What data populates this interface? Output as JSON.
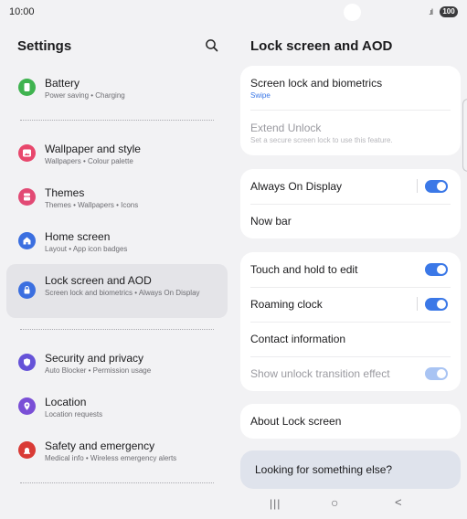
{
  "status": {
    "time": "10:00",
    "signal": ".ıl",
    "battery": "100"
  },
  "left": {
    "title": "Settings",
    "items": [
      {
        "title": "Battery",
        "sub": "Power saving  •  Charging",
        "icon": "battery-icon",
        "color": "#3fb34f"
      },
      {
        "title": "Wallpaper and style",
        "sub": "Wallpapers  •  Colour palette",
        "icon": "wallpaper-icon",
        "color": "#e8476c"
      },
      {
        "title": "Themes",
        "sub": "Themes  •  Wallpapers  •  Icons",
        "icon": "themes-icon",
        "color": "#e24a74"
      },
      {
        "title": "Home screen",
        "sub": "Layout  •  App icon badges",
        "icon": "home-icon",
        "color": "#3b6fe0"
      },
      {
        "title": "Lock screen and AOD",
        "sub": "Screen lock and biometrics  •  Always On Display",
        "icon": "lock-icon",
        "color": "#3b6fe0"
      },
      {
        "title": "Security and privacy",
        "sub": "Auto Blocker  •  Permission usage",
        "icon": "shield-icon",
        "color": "#6653d8"
      },
      {
        "title": "Location",
        "sub": "Location requests",
        "icon": "location-pin-icon",
        "color": "#7a4fd6"
      },
      {
        "title": "Safety and emergency",
        "sub": "Medical info  •  Wireless emergency alerts",
        "icon": "emergency-icon",
        "color": "#d93b36"
      }
    ]
  },
  "right": {
    "title": "Lock screen and AOD",
    "screen_lock": {
      "title": "Screen lock and biometrics",
      "sub": "Swipe"
    },
    "extend_unlock": {
      "title": "Extend Unlock",
      "sub": "Set a secure screen lock to use this feature."
    },
    "always_on": {
      "title": "Always On Display",
      "on": true
    },
    "now_bar": {
      "title": "Now bar"
    },
    "touch_hold": {
      "title": "Touch and hold to edit",
      "on": true
    },
    "roaming_clock": {
      "title": "Roaming clock",
      "on": true
    },
    "contact_info": {
      "title": "Contact information"
    },
    "unlock_effect": {
      "title": "Show unlock transition effect",
      "on": true
    },
    "about": {
      "title": "About Lock screen"
    },
    "looking": {
      "text": "Looking for something else?"
    }
  },
  "navbar": {
    "recents": "|||",
    "home": "○",
    "back": "<"
  },
  "colors": {
    "accent": "#3b78e7",
    "background": "#f2f2f4",
    "card": "#ffffff",
    "active_item": "#e4e4e8"
  }
}
